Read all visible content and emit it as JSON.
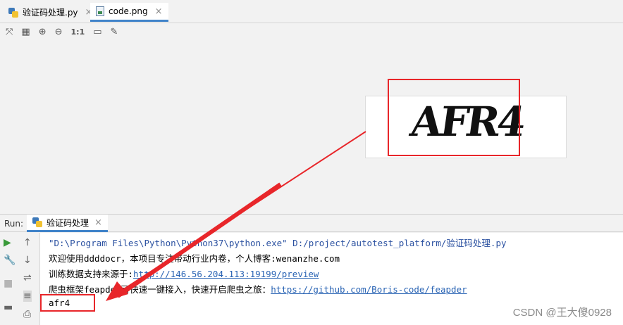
{
  "tabs": [
    {
      "label": "验证码处理.py",
      "icon": "python-file-icon"
    },
    {
      "label": "code.png",
      "icon": "image-file-icon"
    }
  ],
  "image_tools": {
    "actual_size": "1:1"
  },
  "captcha": {
    "text": "AFR4"
  },
  "run": {
    "label": "Run:",
    "tab_label": "验证码处理"
  },
  "console": {
    "cmd_line": "\"D:\\Program Files\\Python\\Python37\\python.exe\" D:/project/autotest_platform/验证码处理.py",
    "line2": "欢迎使用ddddocr，本项目专注带动行业内卷，个人博客:wenanzhe.com",
    "line3_prefix": "训练数据支持来源于:",
    "line3_link": "http://146.56.204.113:19199/preview",
    "line4_prefix": "爬虫框架feapder可快速一键接入，快速开启爬虫之旅：",
    "line4_link": "https://github.com/Boris-code/feapder",
    "result": "afr4"
  },
  "watermark": "CSDN @王大傻0928",
  "colors": {
    "annotation": "#e8262a",
    "accent": "#4083c9",
    "link": "#2a64b4"
  }
}
